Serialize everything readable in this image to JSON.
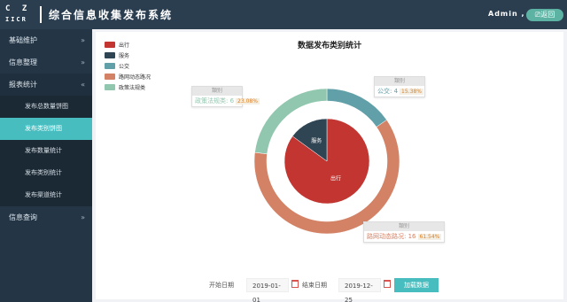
{
  "header": {
    "logo_top": "C Z",
    "logo_bottom": "IICR",
    "title": "综合信息收集发布系统",
    "user": "Admin ,",
    "return_label": "⎚返回"
  },
  "sidebar": {
    "items": [
      {
        "label": "基础维护",
        "chevron": "»"
      },
      {
        "label": "信息整理",
        "chevron": "»"
      },
      {
        "label": "报表统计",
        "chevron": "«"
      },
      {
        "label": "信息查询",
        "chevron": "»"
      }
    ],
    "sub_items": [
      {
        "label": "发布总数量饼图"
      },
      {
        "label": "发布类别饼图"
      },
      {
        "label": "发布数量统计"
      },
      {
        "label": "发布类别统计"
      },
      {
        "label": "发布渠道统计"
      }
    ]
  },
  "chart_data": {
    "type": "pie",
    "title": "数据发布类别统计",
    "legend": [
      "出行",
      "服务",
      "公交",
      "路网动态路况",
      "政策法规类"
    ],
    "colors": {
      "出行": "#c23531",
      "服务": "#2f4554",
      "公交": "#61a0a8",
      "路网动态路况": "#d48265",
      "政策法规类": "#91c7ae"
    },
    "inner_series": [
      {
        "name": "出行",
        "share": 0.85
      },
      {
        "name": "服务",
        "share": 0.15
      }
    ],
    "inner_labels": [
      "出行",
      "服务"
    ],
    "outer_series": [
      {
        "name": "公交",
        "value": 4,
        "percent": "15.38%"
      },
      {
        "name": "路网动态路况",
        "value": 16,
        "percent": "61.54%"
      },
      {
        "name": "政策法规类",
        "value": 6,
        "percent": "23.08%"
      }
    ],
    "callouts": [
      {
        "cap": "類别",
        "text": "公交: 4",
        "pct": "15.38%",
        "color": "#61a0a8"
      },
      {
        "cap": "類别",
        "text": "路网动态路况: 16",
        "pct": "61.54%",
        "color": "#d48265"
      },
      {
        "cap": "類别",
        "text": "政策法规类: 6",
        "pct": "23.08%",
        "color": "#91c7ae"
      }
    ]
  },
  "footer": {
    "start_label": "开始日期",
    "start_value": "2019-01-01",
    "end_label": "结束日期",
    "end_value": "2019-12-25",
    "load_label": "加载数据"
  }
}
